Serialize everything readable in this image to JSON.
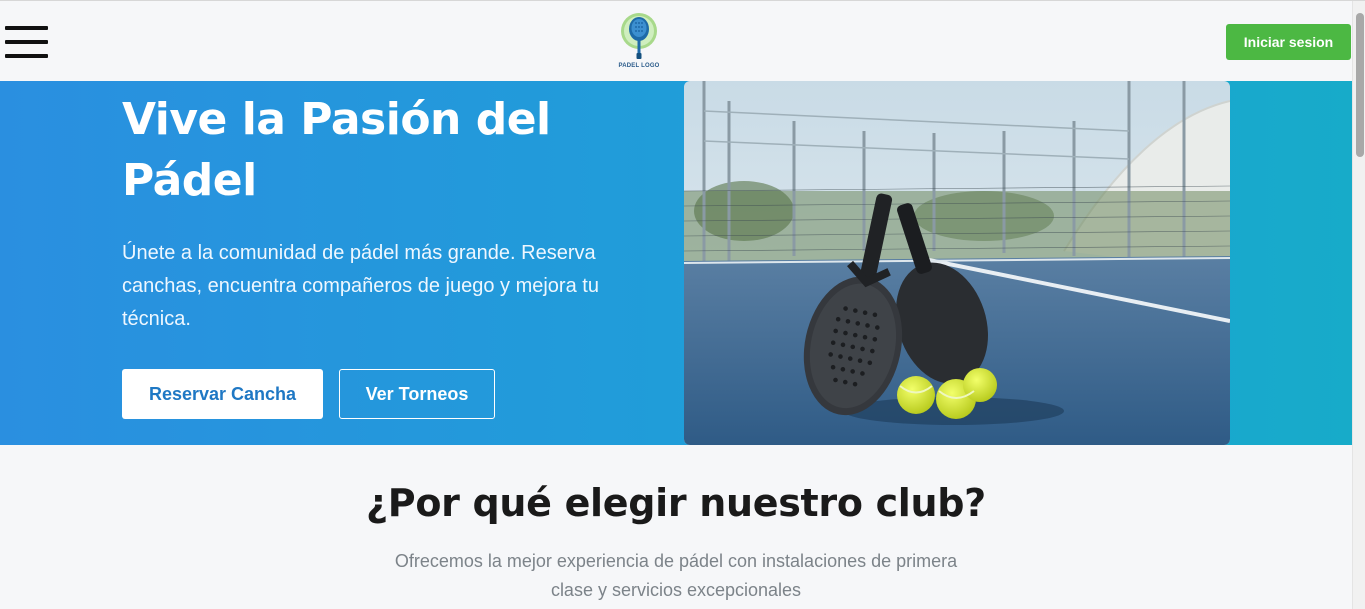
{
  "header": {
    "logo_text": "PADEL LOGO",
    "login_label": "Iniciar sesion"
  },
  "hero": {
    "title_line1": "Vive la Pasión del",
    "title_line2": "Pádel",
    "subtitle": "Únete a la comunidad de pádel más grande. Reserva canchas, encuentra compañeros de juego y mejora tu técnica.",
    "primary_button": "Reservar Cancha",
    "secondary_button": "Ver Torneos",
    "image_name": "padel-rackets-on-court"
  },
  "section": {
    "title": "¿Por qué elegir nuestro club?",
    "subtitle": "Ofrecemos la mejor experiencia de pádel con instalaciones de primera clase y servicios excepcionales"
  },
  "colors": {
    "hero_gradient_start": "#2a8fe0",
    "hero_gradient_end": "#17abc9",
    "login_button": "#4cb843",
    "primary_text_blue": "#1f78c4"
  }
}
